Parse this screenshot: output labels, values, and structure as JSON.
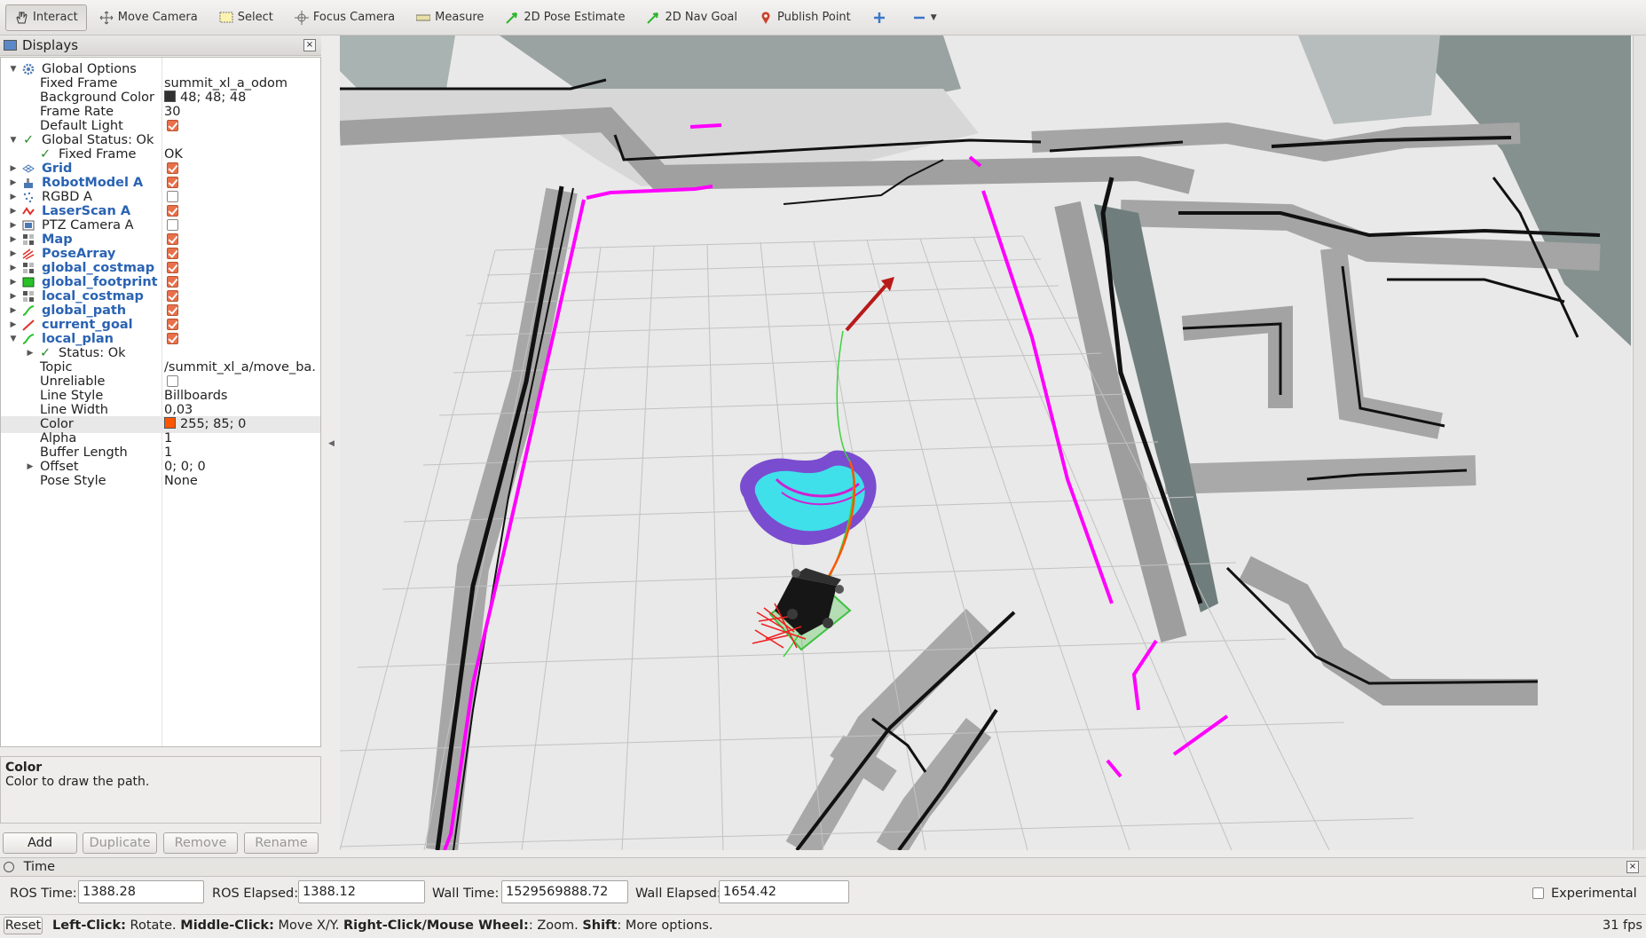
{
  "toolbar": {
    "tools": [
      {
        "label": "Interact",
        "icon": "hand-icon",
        "active": true
      },
      {
        "label": "Move Camera",
        "icon": "move-camera-icon"
      },
      {
        "label": "Select",
        "icon": "select-box-icon"
      },
      {
        "label": "Focus Camera",
        "icon": "focus-crosshair-icon"
      },
      {
        "label": "Measure",
        "icon": "ruler-icon"
      },
      {
        "label": "2D Pose Estimate",
        "icon": "green-arrow-icon"
      },
      {
        "label": "2D Nav Goal",
        "icon": "green-arrow-icon"
      },
      {
        "label": "Publish Point",
        "icon": "map-pin-icon"
      }
    ]
  },
  "displays": {
    "title": "Displays",
    "rows": [
      {
        "name": "Global Options",
        "value": ""
      },
      {
        "name": "Fixed Frame",
        "value": "summit_xl_a_odom"
      },
      {
        "name": "Background Color",
        "value": "48; 48; 48",
        "swatch": "#303030"
      },
      {
        "name": "Frame Rate",
        "value": "30"
      },
      {
        "name": "Default Light",
        "value": "",
        "checkbox": true
      },
      {
        "name": "Global Status: Ok",
        "value": ""
      },
      {
        "name": "Fixed Frame",
        "value": "OK"
      },
      {
        "name": "Grid",
        "checkbox": true
      },
      {
        "name": "RobotModel A",
        "checkbox": true
      },
      {
        "name": "RGBD A",
        "checkbox": false
      },
      {
        "name": "LaserScan A",
        "checkbox": true
      },
      {
        "name": "PTZ Camera A",
        "checkbox": false
      },
      {
        "name": "Map",
        "checkbox": true
      },
      {
        "name": "PoseArray",
        "checkbox": true
      },
      {
        "name": "global_costmap",
        "checkbox": true
      },
      {
        "name": "global_footprint",
        "checkbox": true
      },
      {
        "name": "local_costmap",
        "checkbox": true
      },
      {
        "name": "global_path",
        "checkbox": true
      },
      {
        "name": "current_goal",
        "checkbox": true
      },
      {
        "name": "local_plan",
        "checkbox": true
      },
      {
        "name": "Status: Ok",
        "value": ""
      },
      {
        "name": "Topic",
        "value": "/summit_xl_a/move_ba..."
      },
      {
        "name": "Unreliable",
        "checkbox": false
      },
      {
        "name": "Line Style",
        "value": "Billboards"
      },
      {
        "name": "Line Width",
        "value": "0,03"
      },
      {
        "name": "Color",
        "value": "255; 85; 0",
        "swatch": "#ff5500"
      },
      {
        "name": "Alpha",
        "value": "1"
      },
      {
        "name": "Buffer Length",
        "value": "1"
      },
      {
        "name": "Offset",
        "value": "0; 0; 0"
      },
      {
        "name": "Pose Style",
        "value": "None"
      }
    ],
    "description_title": "Color",
    "description_text": "Color to draw the path.",
    "buttons": {
      "add": "Add",
      "duplicate": "Duplicate",
      "remove": "Remove",
      "rename": "Rename"
    }
  },
  "time": {
    "title": "Time",
    "ros_time_label": "ROS Time:",
    "ros_time": "1388.28",
    "ros_elapsed_label": "ROS Elapsed:",
    "ros_elapsed": "1388.12",
    "wall_time_label": "Wall Time:",
    "wall_time": "1529569888.72",
    "wall_elapsed_label": "Wall Elapsed:",
    "wall_elapsed": "1654.42",
    "experimental_label": "Experimental"
  },
  "status": {
    "reset": "Reset",
    "left_click": "Left-Click:",
    "left_click_text": " Rotate. ",
    "middle_click": "Middle-Click:",
    "middle_click_text": " Move X/Y. ",
    "right_click": "Right-Click/Mouse Wheel:",
    "right_click_text": ": Zoom. ",
    "shift": "Shift",
    "shift_text": ": More options.",
    "fps": "31 fps"
  },
  "colors": {
    "checkbox_on": "#e9704a",
    "link_blue": "#2a63b3",
    "scan_magenta": "#ff00ff",
    "local_plan": "#ff5500"
  }
}
